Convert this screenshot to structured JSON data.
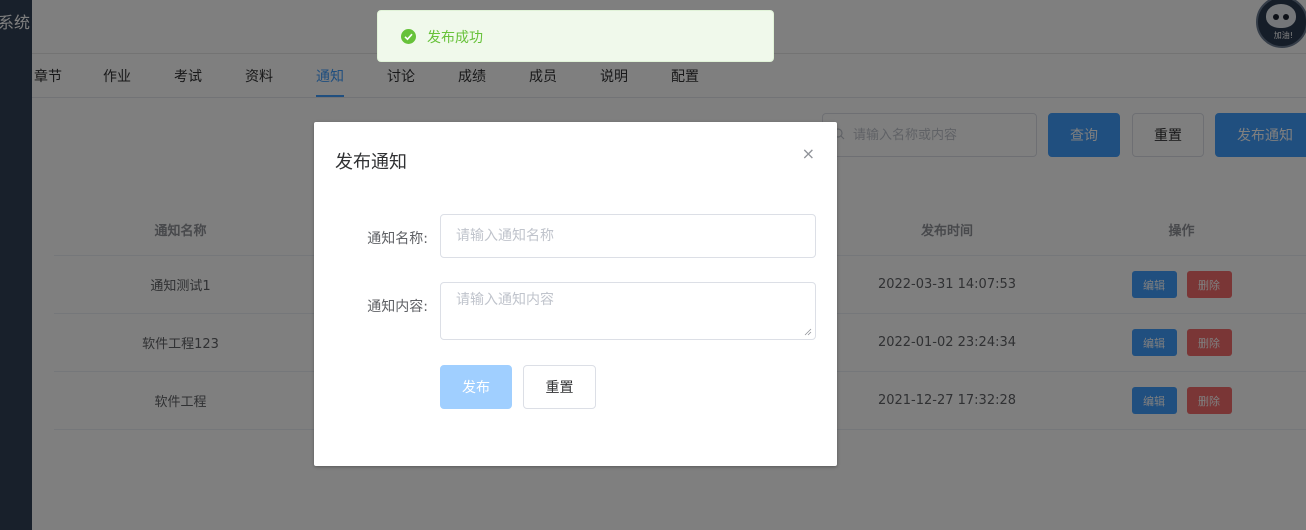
{
  "app": {
    "brand_fragment": "系统"
  },
  "avatar": {
    "badge_text": "加油!"
  },
  "tabs": [
    {
      "label": "章节"
    },
    {
      "label": "作业"
    },
    {
      "label": "考试"
    },
    {
      "label": "资料"
    },
    {
      "label": "通知",
      "active": true
    },
    {
      "label": "讨论"
    },
    {
      "label": "成绩"
    },
    {
      "label": "成员"
    },
    {
      "label": "说明"
    },
    {
      "label": "配置"
    }
  ],
  "toolbar": {
    "search_placeholder": "请输入名称或内容",
    "query_label": "查询",
    "reset_label": "重置",
    "publish_label": "发布通知"
  },
  "table": {
    "headers": {
      "name": "通知名称",
      "time": "发布时间",
      "ops": "操作"
    },
    "rows": [
      {
        "name": "通知测试1",
        "time": "2022-03-31 14:07:53",
        "edit": "编辑",
        "delete": "删除"
      },
      {
        "name": "软件工程123",
        "time": "2022-01-02 23:24:34",
        "edit": "编辑",
        "delete": "删除"
      },
      {
        "name": "软件工程",
        "time": "2021-12-27 17:32:28",
        "edit": "编辑",
        "delete": "删除"
      }
    ]
  },
  "dialog": {
    "title": "发布通知",
    "close_glyph": "×",
    "name_label": "通知名称:",
    "name_placeholder": "请输入通知名称",
    "content_label": "通知内容:",
    "content_placeholder": "请输入通知内容",
    "submit_label": "发布",
    "reset_label": "重置"
  },
  "toast": {
    "message": "发布成功",
    "status": "success"
  },
  "colors": {
    "primary": "#409eff",
    "danger": "#f56c6c",
    "success": "#67c23a",
    "sidebar": "#304156"
  }
}
